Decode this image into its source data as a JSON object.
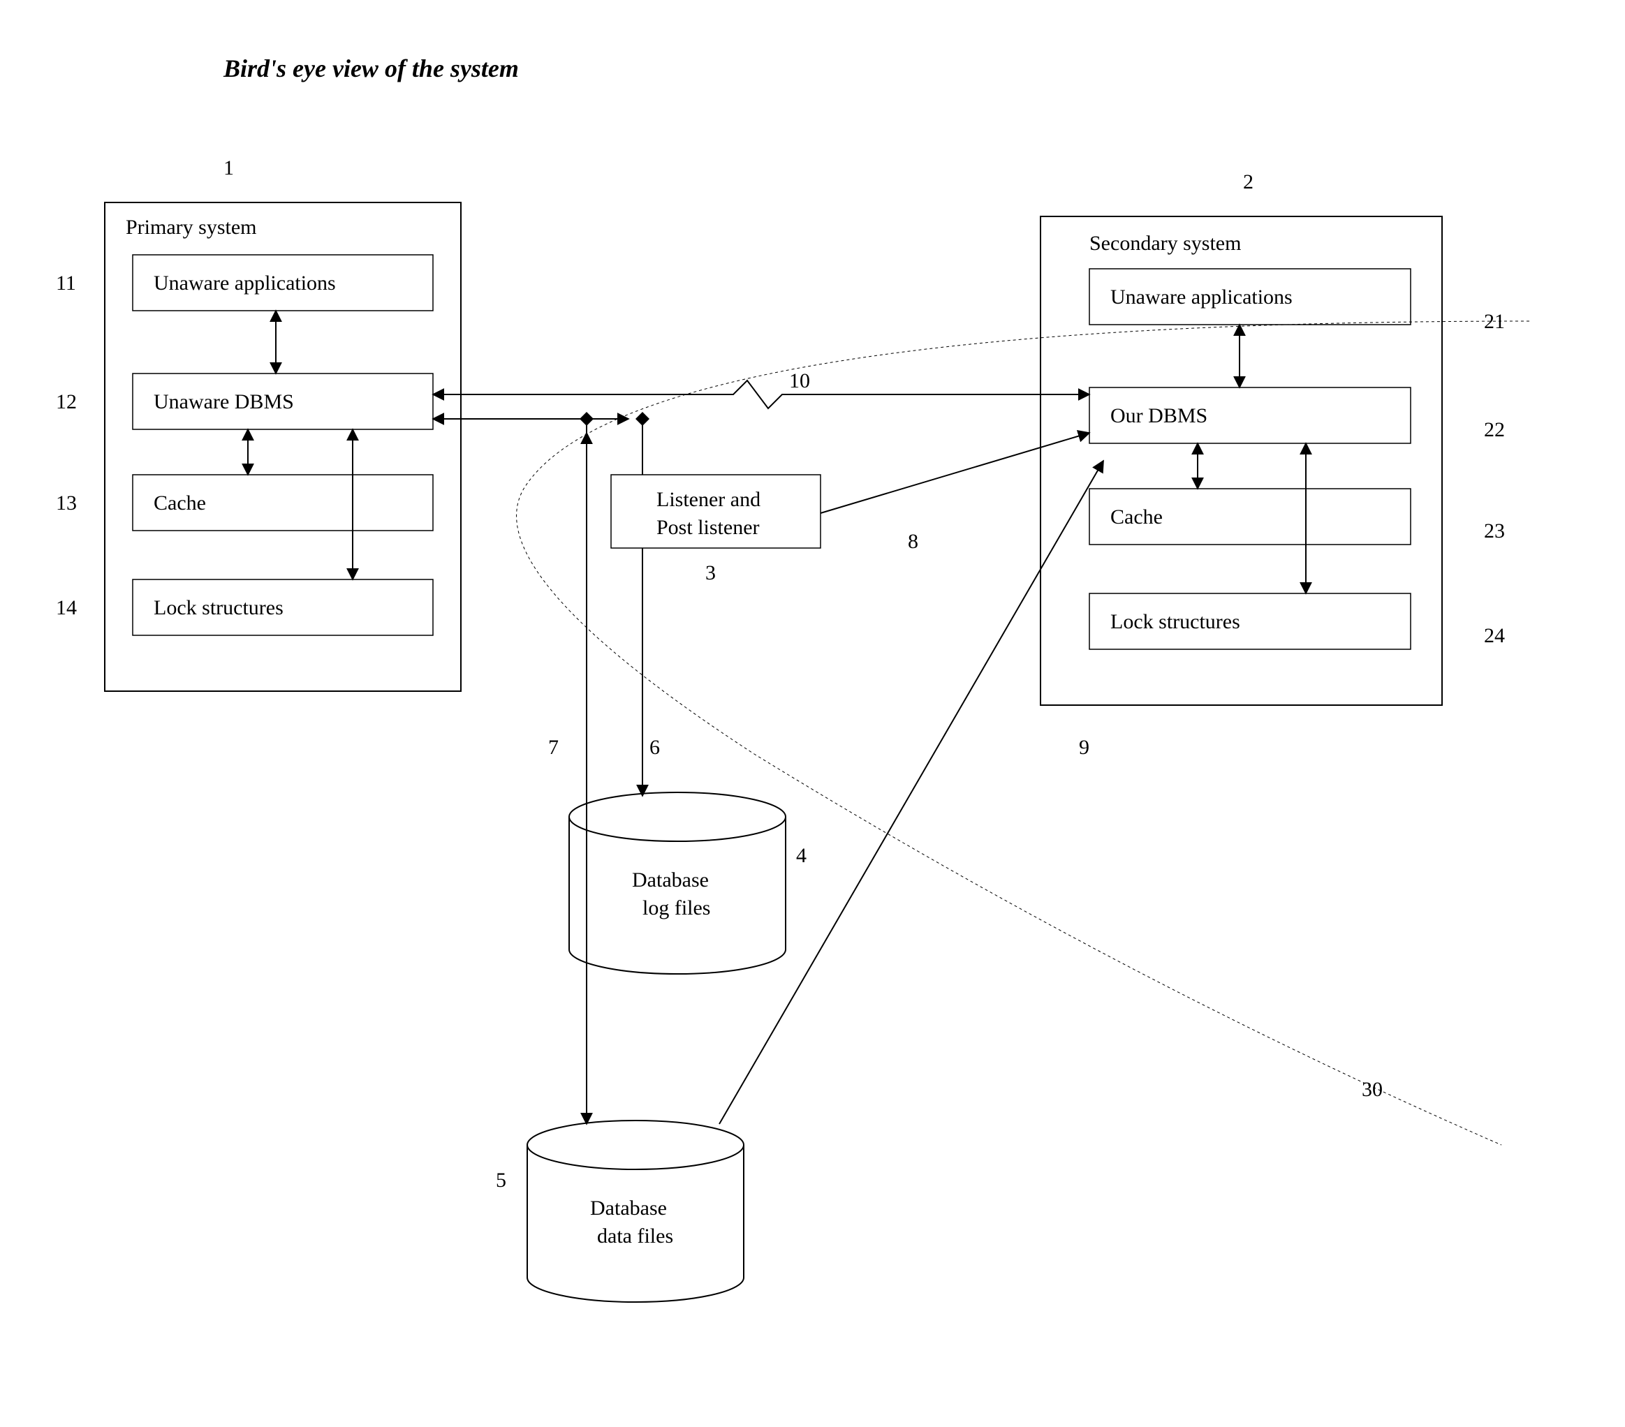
{
  "title": "Bird's eye view of the system",
  "primary": {
    "title": "Primary system",
    "apps": "Unaware applications",
    "dbms": "Unaware DBMS",
    "cache": "Cache",
    "locks": "Lock structures"
  },
  "secondary": {
    "title": "Secondary system",
    "apps": "Unaware applications",
    "dbms": "Our DBMS",
    "cache": "Cache",
    "locks": "Lock structures"
  },
  "listener": {
    "line1": "Listener and",
    "line2": "Post listener"
  },
  "logfiles": {
    "line1": "Database",
    "line2": "log files"
  },
  "datafiles": {
    "line1": "Database",
    "line2": "data files"
  },
  "nums": {
    "n1": "1",
    "n2": "2",
    "n3": "3",
    "n4": "4",
    "n5": "5",
    "n6": "6",
    "n7": "7",
    "n8": "8",
    "n9": "9",
    "n10": "10",
    "n11": "11",
    "n12": "12",
    "n13": "13",
    "n14": "14",
    "n21": "21",
    "n22": "22",
    "n23": "23",
    "n24": "24",
    "n30": "30"
  }
}
